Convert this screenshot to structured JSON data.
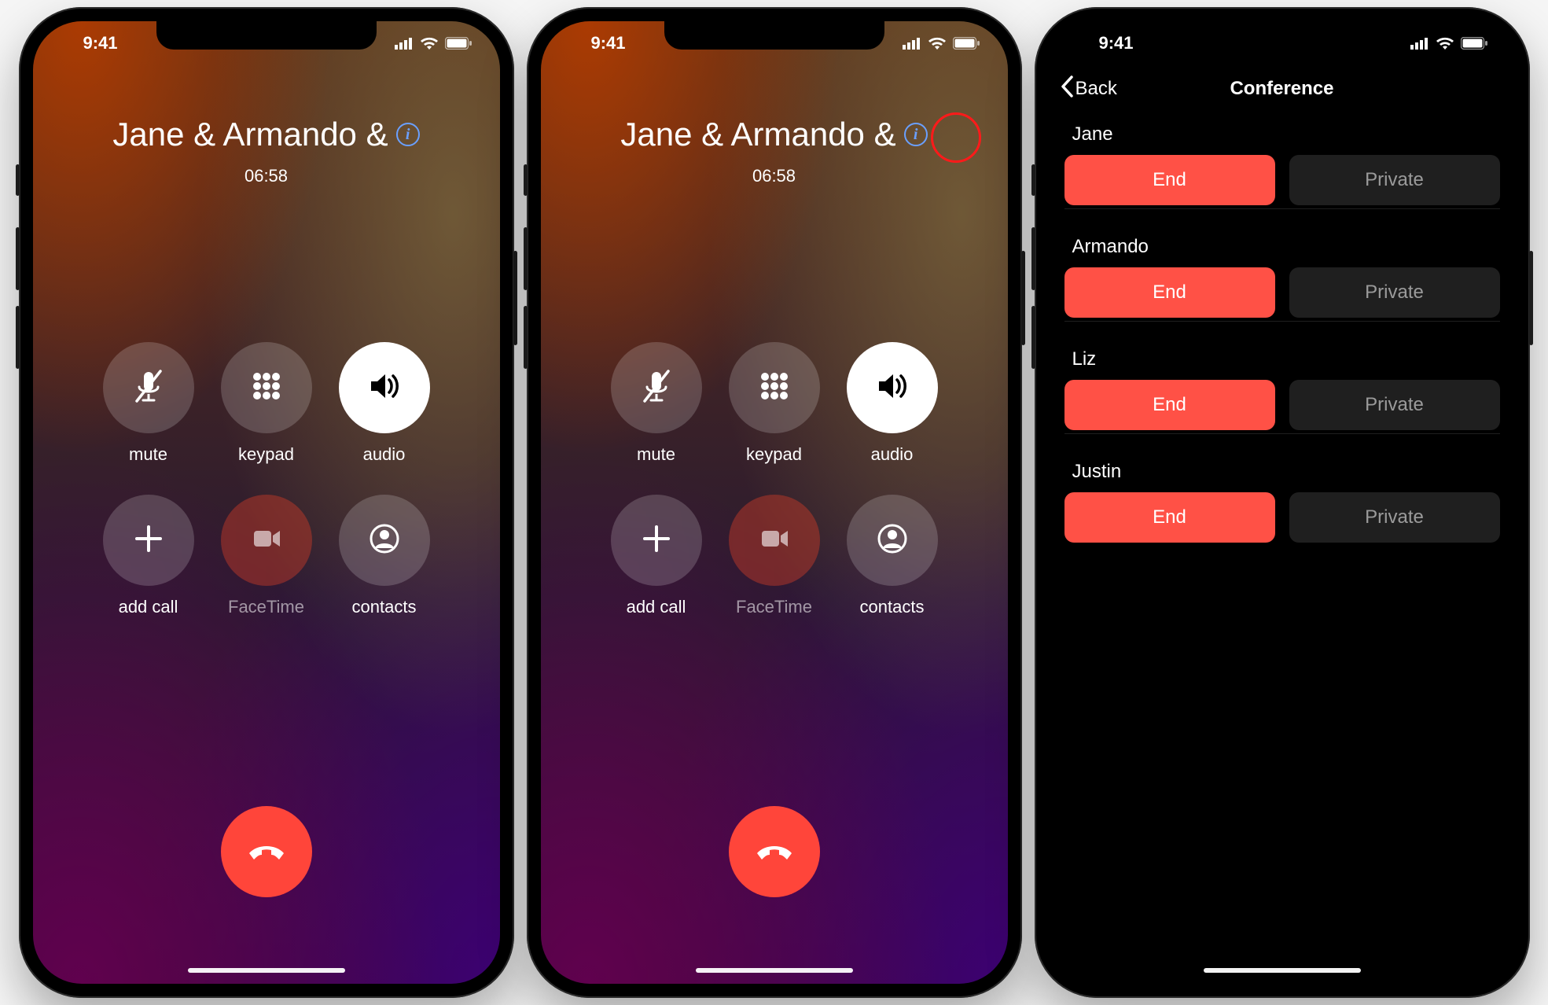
{
  "status": {
    "time": "9:41"
  },
  "call": {
    "title": "Jane & Armando & ",
    "duration": "06:58"
  },
  "buttons": {
    "mute": "mute",
    "keypad": "keypad",
    "audio": "audio",
    "addcall": "add call",
    "facetime": "FaceTime",
    "contacts": "contacts"
  },
  "conference": {
    "back": "Back",
    "title": "Conference",
    "end": "End",
    "private": "Private",
    "participants": [
      "Jane",
      "Armando",
      "Liz",
      "Justin"
    ]
  }
}
